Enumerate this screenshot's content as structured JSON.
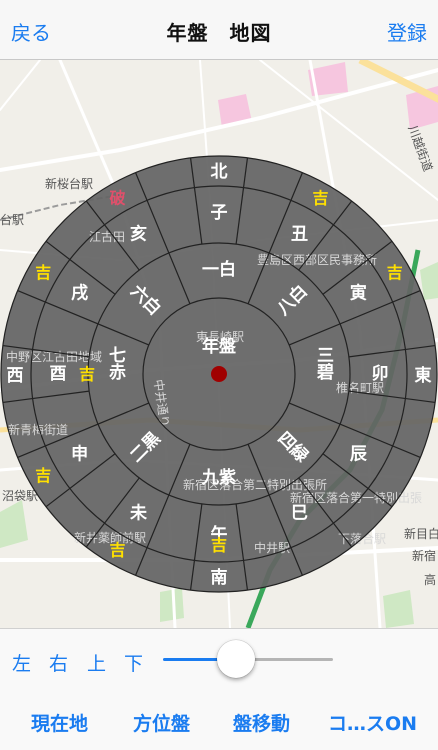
{
  "navbar": {
    "back_label": "戻る",
    "title": "年盤　地図",
    "register_label": "登録"
  },
  "map_labels": {
    "shin_sakuradai": "新桜台駅",
    "egota": "江古田",
    "kawagoe_kaido": "川越街道",
    "dai_station": "台駅",
    "toshima_office": "豊島区西部区民事務所",
    "nakano_egota": "中野区江古田地域",
    "higashi_nagasaki": "東長崎駅",
    "shiina": "椎名町駅",
    "nakai_dori": "中井通り",
    "shin_oume": "新青梅街道",
    "numabukuro": "沼袋駅",
    "shinjuku_ochiai2": "新宿区落合第二特別出張所",
    "shinjuku_ochiai1": "新宿区落合第一特別出張",
    "arai_yakushi": "新井薬師前駅",
    "nakai_station": "中井駅",
    "shimo_ochiai": "下落合駅",
    "shin_mejiro": "新目白",
    "shinjuku_label": "新宿",
    "top_right": "高"
  },
  "compass": {
    "center_label": "年盤",
    "directions": {
      "north": "北",
      "south": "南",
      "east": "東",
      "west": "西"
    },
    "zodiac": [
      "子",
      "丑",
      "寅",
      "卯",
      "辰",
      "巳",
      "午",
      "未",
      "申",
      "酉",
      "戌",
      "亥"
    ],
    "stars": {
      "north": "一白",
      "northeast": "八白",
      "east": "三碧",
      "southeast": "四緑",
      "south": "九紫",
      "southwest": "二黒",
      "west": "七赤",
      "northwest": "六白"
    },
    "fortune": {
      "lucky": "吉",
      "broken": "破"
    }
  },
  "controls": {
    "left": "左",
    "right": "右",
    "up": "上",
    "down": "下",
    "slider_value": 0.43,
    "current_location": "現在地",
    "compass_board": "方位盤",
    "board_move": "盤移動",
    "course_on": "コ…スON"
  },
  "colors": {
    "accent": "#1a7cf0",
    "lucky": "#ffe000",
    "broken": "#e0506b",
    "marker": "#b00000"
  }
}
